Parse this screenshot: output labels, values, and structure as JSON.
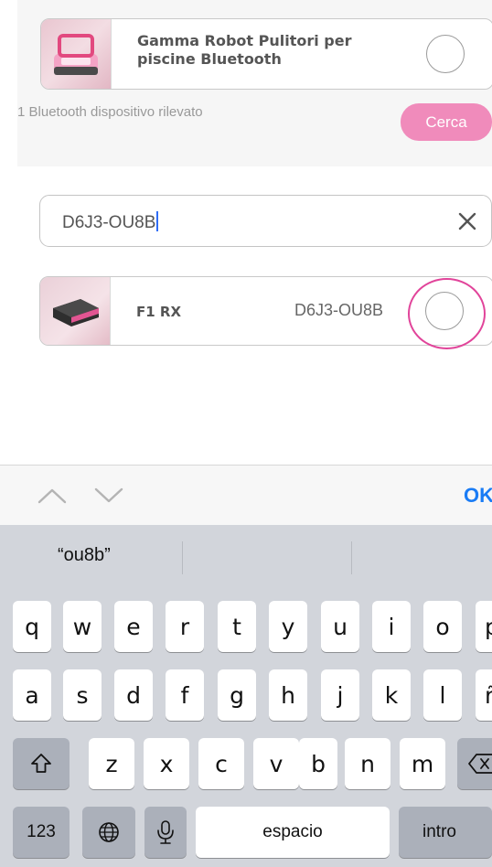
{
  "product_group": {
    "title": "Gamma Robot Pulitori per piscine Bluetooth",
    "thumbnail_icon": "pool-robot-pink-icon"
  },
  "detected_label": "1 Bluetooth dispositivo rilevato",
  "search_button": "Cerca",
  "search": {
    "value": "D6J3-OU8B"
  },
  "device": {
    "model": "F1 RX",
    "serial": "D6J3-OU8B",
    "thumbnail_icon": "pool-robot-dark-icon"
  },
  "keyboard": {
    "done_label": "OK",
    "suggestion": "“ou8b”",
    "row1": [
      "q",
      "w",
      "e",
      "r",
      "t",
      "y",
      "u",
      "i",
      "o",
      "p"
    ],
    "row2": [
      "a",
      "s",
      "d",
      "f",
      "g",
      "h",
      "j",
      "k",
      "l",
      "ñ"
    ],
    "row3": [
      "z",
      "x",
      "c",
      "v",
      "b",
      "n",
      "m"
    ],
    "numbers_label": "123",
    "space_label": "espacio",
    "return_label": "intro"
  },
  "colors": {
    "accent_pink": "#f08bbb",
    "highlight_ring": "#e1449a",
    "ios_blue": "#1a7cf5"
  }
}
